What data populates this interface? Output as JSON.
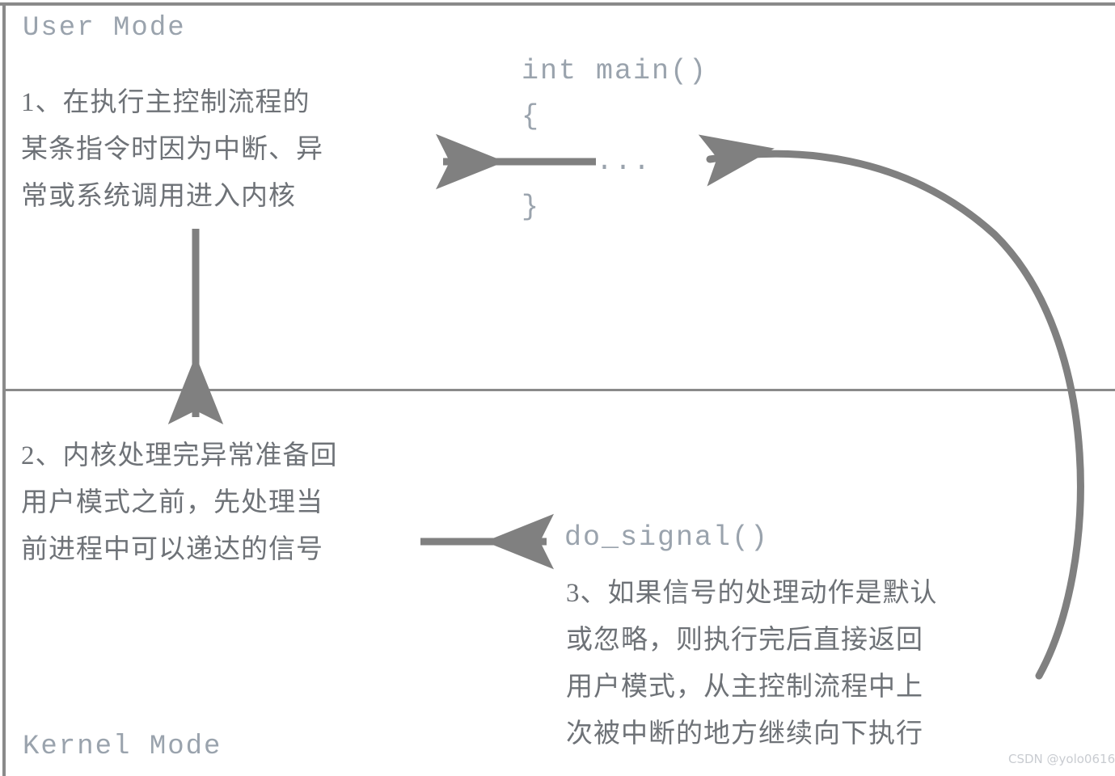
{
  "diagram": {
    "title": "Signal delivery: user mode / kernel mode flow",
    "accent_color": "#808080",
    "frame_color": "#8a8a8a",
    "code_text_color": "#9aa3ad",
    "body_text_color": "#6e7277"
  },
  "sections": {
    "user_mode_label": "User Mode",
    "kernel_mode_label": "Kernel Mode"
  },
  "steps": {
    "step1": "1、在执行主控制流程的\n某条指令时因为中断、异\n常或系统调用进入内核",
    "step2": "2、内核处理完异常准备回\n用户模式之前，先处理当\n前进程中可以递达的信号",
    "step3": "3、如果信号的处理动作是默认\n或忽略，则执行完后直接返回\n用户模式，从主控制流程中上\n次被中断的地方继续向下执行"
  },
  "code": {
    "main_function": "int main()\n{\n    ...\n}",
    "do_signal": "do_signal()"
  },
  "arrows": {
    "enter_kernel": "arrow-down-enter-kernel",
    "return_to_main": "arrow-left-return-to-main",
    "curved_return": "arrow-curved-return-to-main",
    "to_do_signal": "arrow-right-to-do-signal"
  },
  "watermark": "CSDN @yolo0616"
}
